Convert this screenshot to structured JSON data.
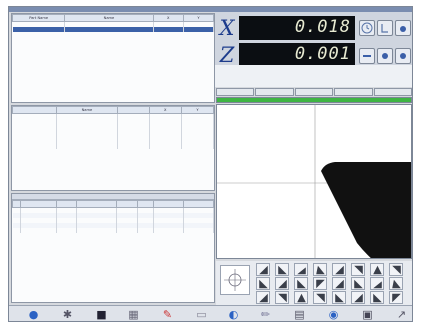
{
  "dro": {
    "x_label": "X",
    "x_value": "0.018",
    "z_label": "Z",
    "z_value": "0.001"
  },
  "features_table": {
    "headers": [
      "Part Name",
      "Name",
      "X",
      "Y"
    ],
    "rows": [
      [
        "",
        "",
        "",
        ""
      ],
      [
        "",
        "",
        "",
        ""
      ]
    ]
  },
  "elements_table": {
    "headers": [
      "",
      "Name",
      "",
      "X",
      "Y"
    ],
    "rows": [
      [
        "",
        "",
        "",
        "",
        ""
      ],
      [
        "",
        "",
        "",
        "",
        ""
      ],
      [
        "",
        "",
        "",
        "",
        ""
      ],
      [
        "",
        "",
        "",
        "",
        ""
      ],
      [
        "",
        "",
        "",
        "",
        ""
      ],
      [
        "",
        "",
        "",
        "",
        ""
      ],
      [
        "",
        "",
        "",
        "",
        ""
      ]
    ]
  },
  "results_table": {
    "title": "",
    "headers": [
      "",
      "",
      "",
      "",
      "",
      "",
      "",
      ""
    ],
    "rows": [
      [
        "",
        "",
        "",
        "",
        "",
        "",
        "",
        ""
      ],
      [
        "",
        "",
        "",
        "",
        "",
        "",
        "",
        ""
      ],
      [
        "",
        "",
        "",
        "",
        "",
        "",
        "",
        ""
      ],
      [
        "",
        "",
        "",
        "",
        "",
        "",
        "",
        ""
      ],
      [
        "",
        "",
        "",
        "",
        "",
        "",
        "",
        ""
      ]
    ]
  },
  "progress": {
    "value": 1.0,
    "color": "#3fb543"
  },
  "colors": {
    "accent": "#1d3c8c",
    "readout_bg": "#0b0e12",
    "selection": "#3b61a8"
  },
  "toolbar_icons": [
    "globe-icon",
    "wrench-icon",
    "camera-icon",
    "grid-icon",
    "pen-icon",
    "ruler-icon",
    "measure-icon",
    "pencil-icon",
    "table-icon",
    "record-icon",
    "trash-icon",
    "arrow-icon"
  ]
}
